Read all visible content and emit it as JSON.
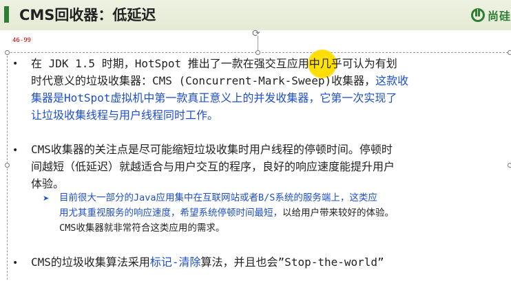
{
  "slide": {
    "title": "CMS回收器：低延迟",
    "logo_text": "尚硅",
    "page_ref": "46-99"
  },
  "bullets": [
    {
      "lines": [
        [
          {
            "t": "在 JDK 1.5 时期，HotSpot 推出了一款在强交互应用中几乎可认为有划",
            "c": "black"
          }
        ],
        [
          {
            "t": "时代意义的垃圾收集器：CMS (Concurrent-Mark-Sweep)收集器，",
            "c": "black"
          },
          {
            "t": "这款收",
            "c": "blue"
          }
        ],
        [
          {
            "t": "集器是HotSpot虚拟机中第一款真正意义上的并发收集器，它第一次实现了",
            "c": "blue"
          }
        ],
        [
          {
            "t": "让垃圾收集线程与用户线程同时工作。",
            "c": "blue"
          }
        ]
      ]
    },
    {
      "lines": [
        [
          {
            "t": "CMS收集器的关注点是尽可能缩短垃圾收集时用户线程的停顿时间。停顿时",
            "c": "black"
          }
        ],
        [
          {
            "t": "间越短（低延迟）就越适合与用户交互的程序，良好的响应速度能提升用户",
            "c": "black"
          }
        ],
        [
          {
            "t": "体验。",
            "c": "black"
          }
        ]
      ],
      "sub": [
        [
          {
            "t": "目前很大一部分的Java应用集中在互联网站或者B/S系统的服务端上，这类应",
            "c": "blue"
          }
        ],
        [
          {
            "t": "用尤其重视服务的响应速度，希望系统停顿时间最短，",
            "c": "blue"
          },
          {
            "t": "以给用户带来较好的体验。",
            "c": "black"
          }
        ],
        [
          {
            "t": "CMS收集器就非常符合这类应用的需求。",
            "c": "black"
          }
        ]
      ]
    },
    {
      "lines": [
        [
          {
            "t": "CMS的垃圾收集算法采用",
            "c": "black"
          },
          {
            "t": "标记-清除",
            "c": "blue"
          },
          {
            "t": "算法，并且也会”Stop-the-world”",
            "c": "black"
          }
        ]
      ]
    }
  ]
}
